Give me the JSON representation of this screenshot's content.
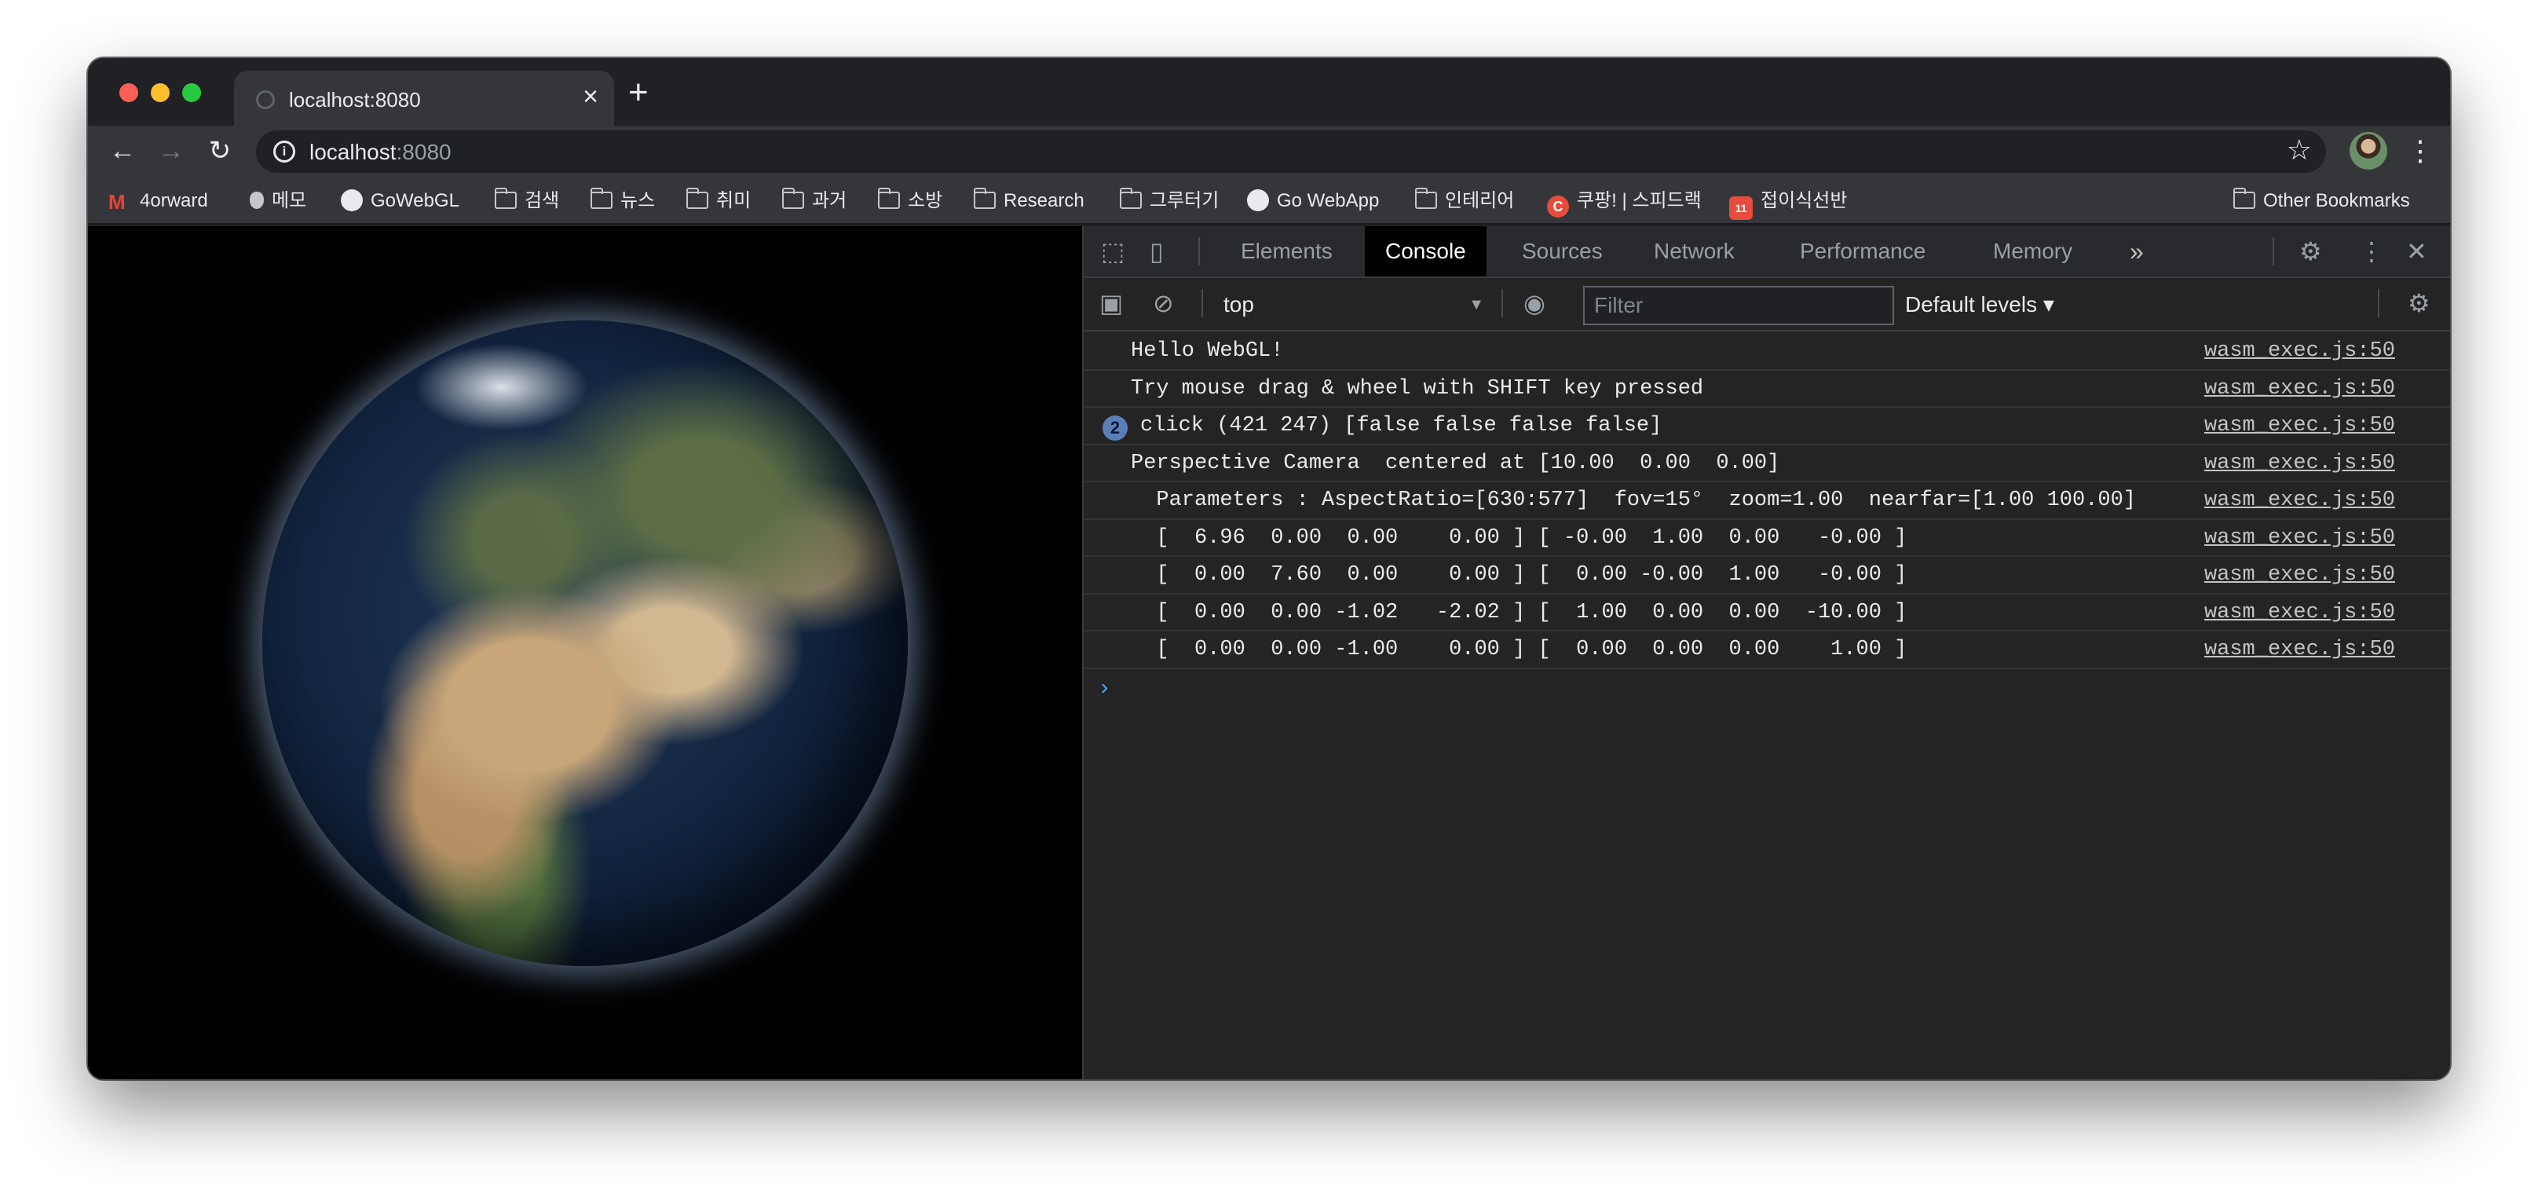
{
  "tab": {
    "title": "localhost:8080",
    "close": "×",
    "new_tab": "+"
  },
  "toolbar": {
    "back": "←",
    "forward": "→",
    "reload": "↻",
    "url_host": "localhost",
    "url_port": ":8080",
    "info_icon": "i",
    "star_icon": "☆",
    "menu": "⋮"
  },
  "bookmarks": [
    {
      "label": "4orward",
      "icon": "gmail-icon"
    },
    {
      "label": "메모",
      "icon": "apple-icon"
    },
    {
      "label": "GoWebGL",
      "icon": "github-icon"
    },
    {
      "label": "검색",
      "icon": "folder-icon"
    },
    {
      "label": "뉴스",
      "icon": "folder-icon"
    },
    {
      "label": "취미",
      "icon": "folder-icon"
    },
    {
      "label": "과거",
      "icon": "folder-icon"
    },
    {
      "label": "소방",
      "icon": "folder-icon"
    },
    {
      "label": "Research",
      "icon": "folder-icon"
    },
    {
      "label": "그루터기",
      "icon": "folder-icon"
    },
    {
      "label": "Go WebApp",
      "icon": "globe-icon"
    },
    {
      "label": "인테리어",
      "icon": "folder-icon"
    },
    {
      "label": "쿠팡! | 스피드랙",
      "icon": "coupang-icon"
    },
    {
      "label": "접이식선반",
      "icon": "site-icon"
    },
    {
      "label": "Other Bookmarks",
      "icon": "folder-icon"
    }
  ],
  "devtools": {
    "tabs": [
      "Elements",
      "Console",
      "Sources",
      "Network",
      "Performance",
      "Memory"
    ],
    "active_tab": "Console",
    "more_tabs": "»",
    "context": "top",
    "filter_placeholder": "Filter",
    "levels": "Default levels ▾",
    "console_logs": [
      {
        "msg": "Hello WebGL!",
        "src": "wasm_exec.js:50"
      },
      {
        "msg": "Try mouse drag & wheel with SHIFT key pressed",
        "src": "wasm_exec.js:50"
      },
      {
        "msg": "click (421 247) [false false false false]",
        "src": "wasm_exec.js:50",
        "repeat": "2"
      },
      {
        "msg": "Perspective Camera  centered at [10.00  0.00  0.00]",
        "src": "wasm_exec.js:50"
      },
      {
        "msg": "  Parameters : AspectRatio=[630:577]  fov=15°  zoom=1.00  nearfar=[1.00 100.00]",
        "src": "wasm_exec.js:50"
      },
      {
        "msg": "  [  6.96  0.00  0.00    0.00 ] [ -0.00  1.00  0.00   -0.00 ]",
        "src": "wasm_exec.js:50"
      },
      {
        "msg": "  [  0.00  7.60  0.00    0.00 ] [  0.00 -0.00  1.00   -0.00 ]",
        "src": "wasm_exec.js:50"
      },
      {
        "msg": "  [  0.00  0.00 -1.02   -2.02 ] [  1.00  0.00  0.00  -10.00 ]",
        "src": "wasm_exec.js:50"
      },
      {
        "msg": "  [  0.00  0.00 -1.00    0.00 ] [  0.00  0.00  0.00    1.00 ]",
        "src": "wasm_exec.js:50"
      }
    ],
    "prompt": "›"
  },
  "colors": {
    "window_bg": "#202124",
    "toolbar_bg": "#35363a",
    "devtools_bg": "#242424",
    "active_tab_bg": "#000000",
    "link_color": "#c4c4c4",
    "prompt_color": "#4da3ff"
  }
}
